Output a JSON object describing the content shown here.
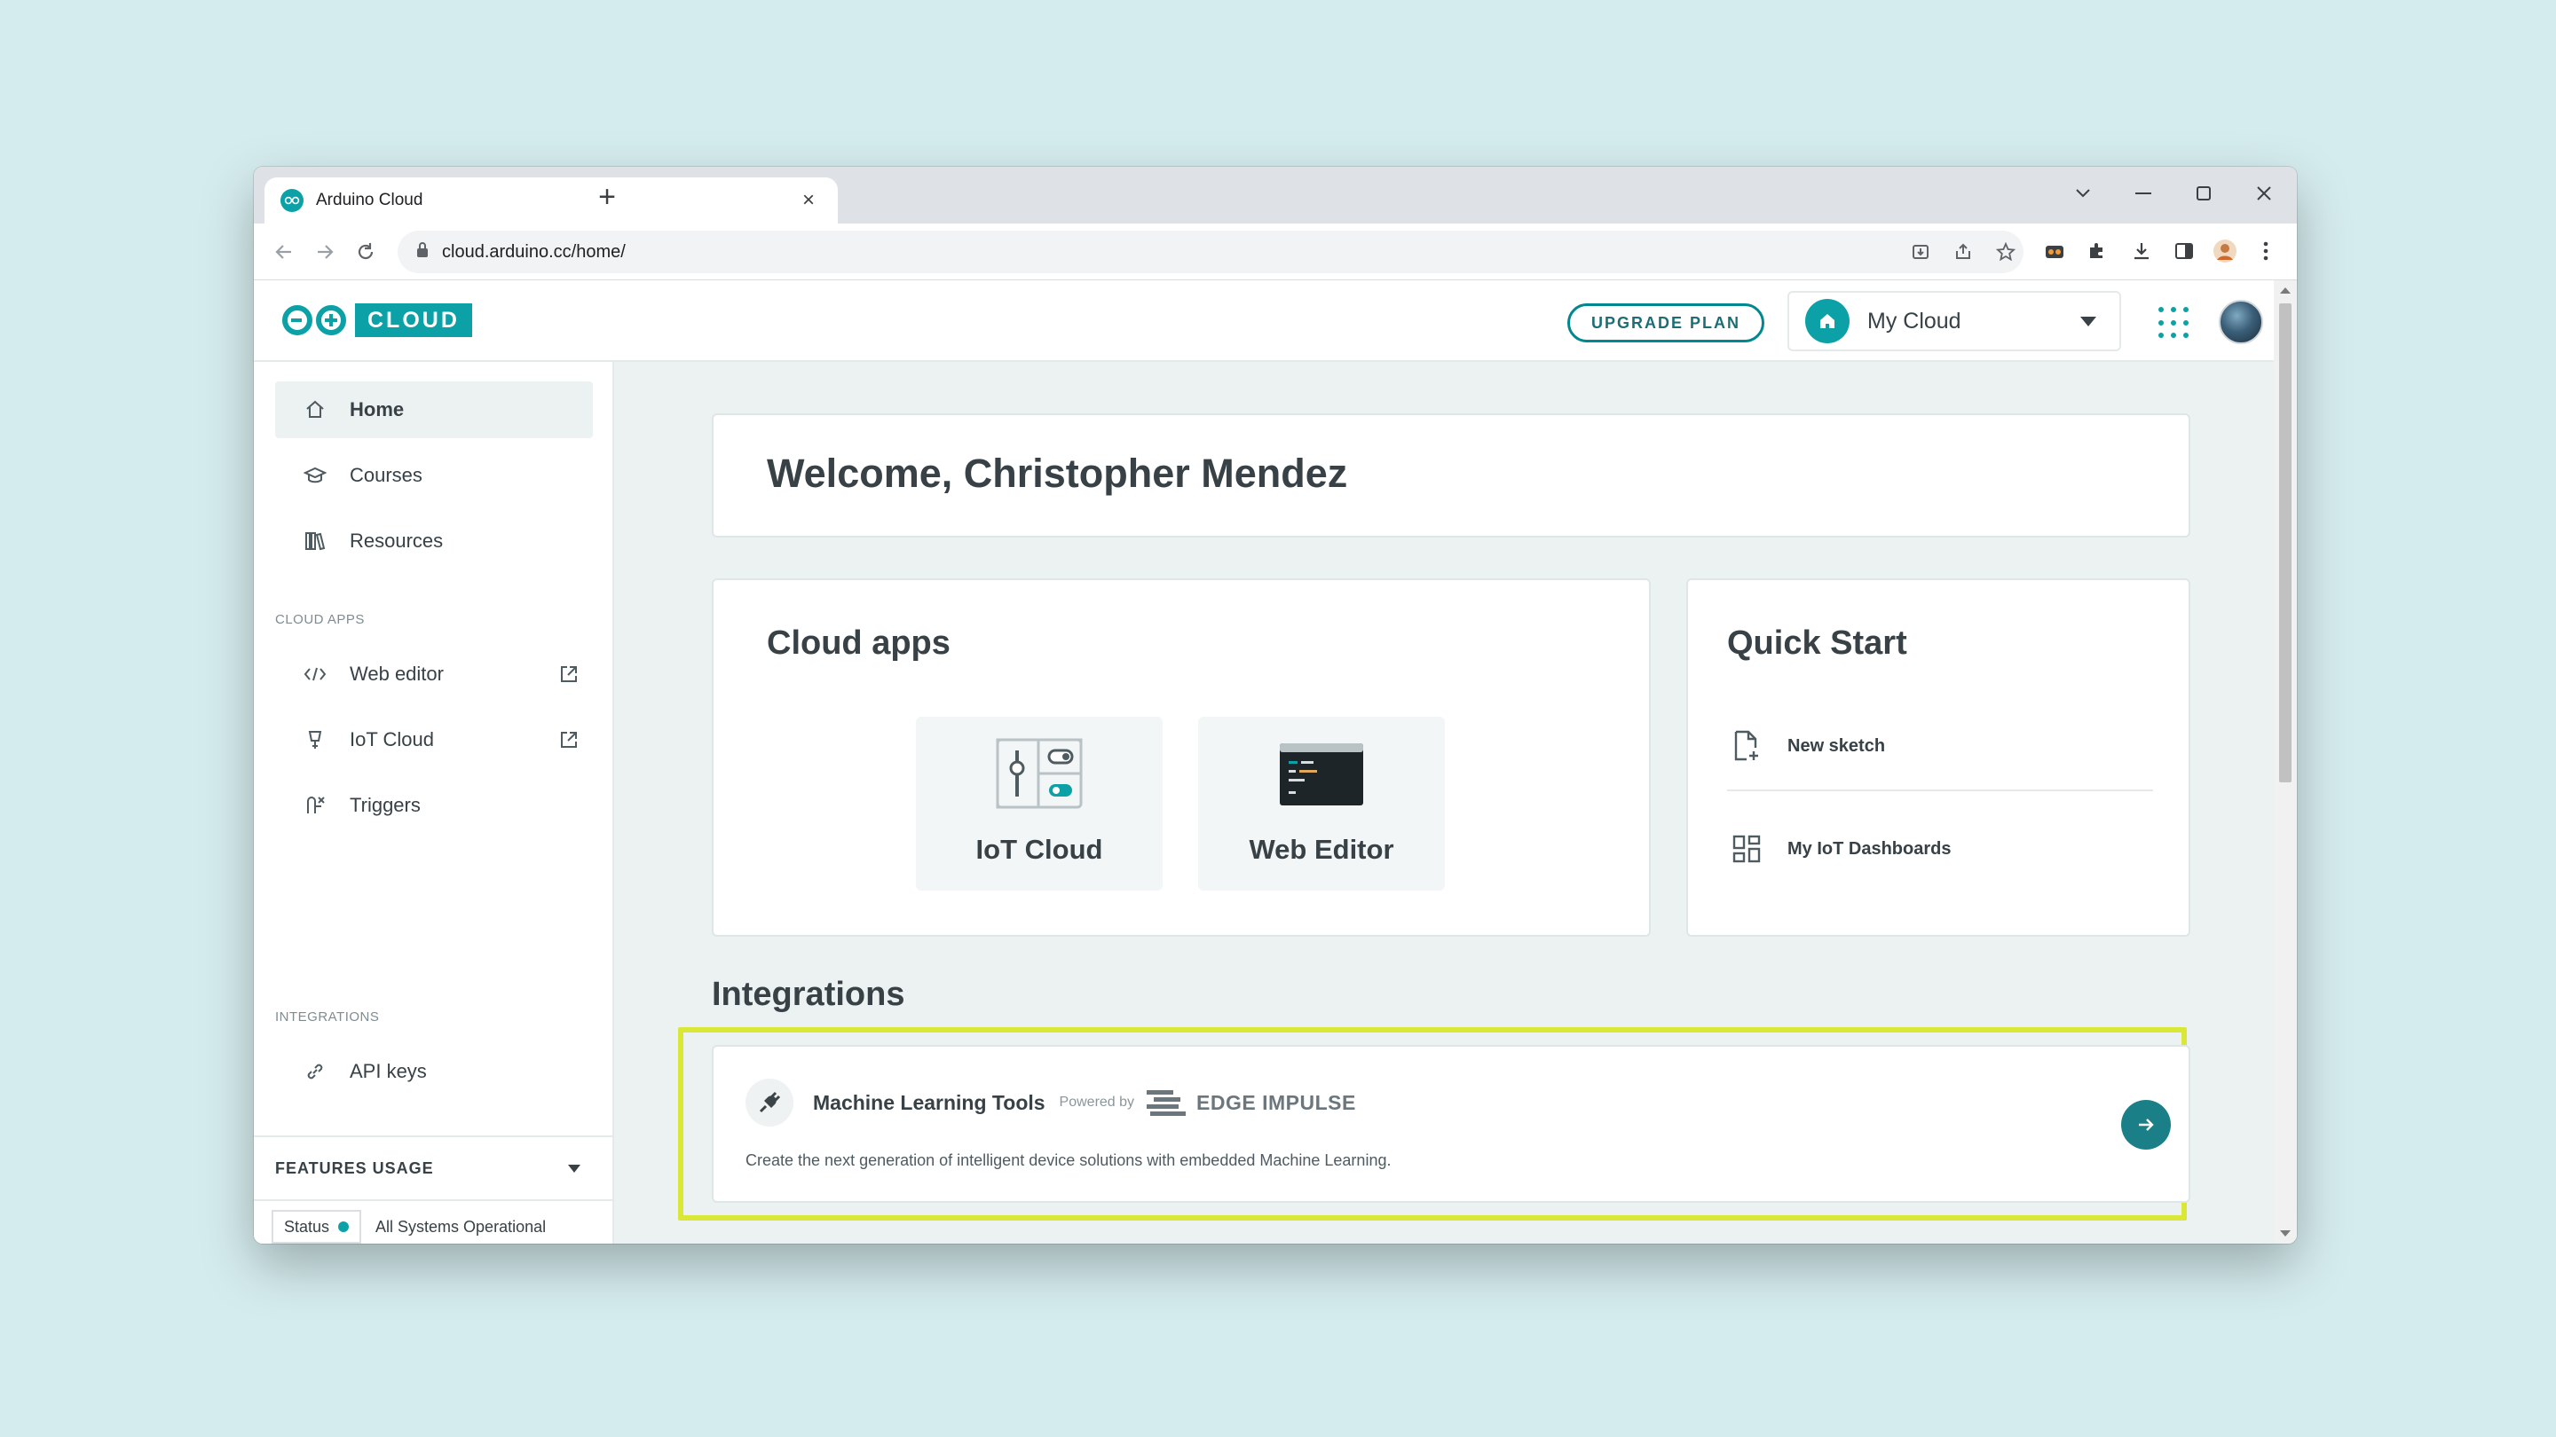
{
  "browser": {
    "tab_title": "Arduino Cloud",
    "tab_close": "×",
    "new_tab": "+",
    "url": "cloud.arduino.cc/home/"
  },
  "header": {
    "logo_word": "CLOUD",
    "upgrade_label": "UPGRADE PLAN",
    "space_name": "My Cloud"
  },
  "sidebar": {
    "home": "Home",
    "courses": "Courses",
    "resources": "Resources",
    "cloud_apps_label": "CLOUD APPS",
    "web_editor": "Web editor",
    "iot_cloud": "IoT Cloud",
    "triggers": "Triggers",
    "integrations_label": "INTEGRATIONS",
    "api_keys": "API keys",
    "features_usage": "FEATURES USAGE",
    "status_label": "Status",
    "status_text": "All Systems Operational"
  },
  "main": {
    "welcome": "Welcome, Christopher Mendez",
    "cloud_apps_title": "Cloud apps",
    "apps": [
      {
        "label": "IoT Cloud"
      },
      {
        "label": "Web Editor"
      }
    ],
    "quick_start_title": "Quick Start",
    "quick_start": [
      {
        "label": "New sketch"
      },
      {
        "label": "My IoT Dashboards"
      }
    ],
    "integrations_title": "Integrations",
    "integration": {
      "title": "Machine Learning Tools",
      "powered_by": "Powered by",
      "partner": "EDGE IMPULSE",
      "description": "Create the next generation of intelligent device solutions with embedded Machine Learning."
    }
  },
  "colors": {
    "accent": "#0ca1a6",
    "highlight": "#dbe737",
    "page_background": "#d5ecee"
  }
}
